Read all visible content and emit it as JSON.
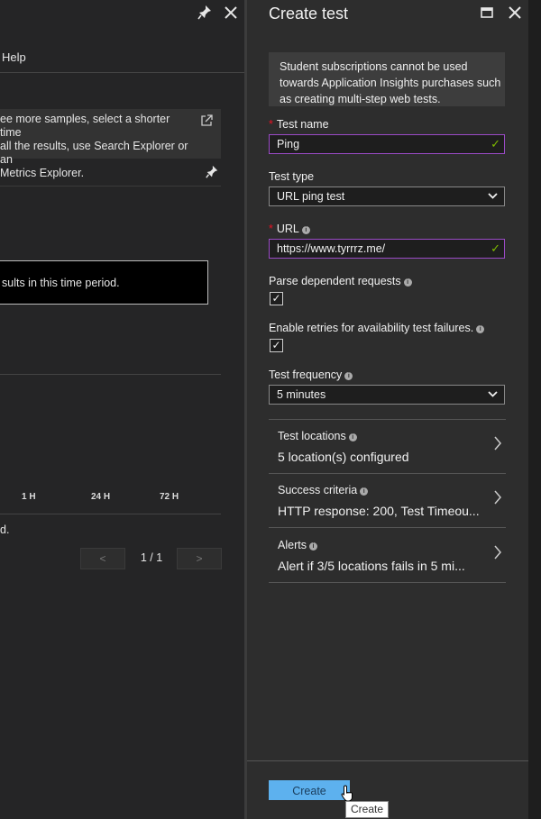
{
  "left_blade": {
    "pin_icon": "pin-icon",
    "close_icon": "close-icon",
    "menu_help": "Help",
    "info_text": "ee more samples, select a shorter time\nall the results, use Search Explorer or an\nMetrics Explorer.",
    "external_link_icon": "external-link-icon",
    "notice": "sults in this time period.",
    "time_ranges": [
      "1 H",
      "24 H",
      "72 H"
    ],
    "truncated_text": "d.",
    "pager": {
      "prev": "<",
      "label": "1 / 1",
      "next": ">"
    }
  },
  "create_test": {
    "title": "Create test",
    "maximize_icon": "maximize-icon",
    "close_icon": "close-icon",
    "notice": "Student subscriptions cannot be used towards Application Insights purchases such as creating multi-step web tests.",
    "test_name": {
      "label": "Test name",
      "required": "*",
      "value": "Ping"
    },
    "test_type": {
      "label": "Test type",
      "value": "URL ping test"
    },
    "url": {
      "label": "URL",
      "required": "*",
      "value": "https://www.tyrrrz.me/"
    },
    "parse_dependent": {
      "label": "Parse dependent requests",
      "checked": true
    },
    "enable_retries": {
      "label": "Enable retries for availability test failures.",
      "checked": true
    },
    "test_frequency": {
      "label": "Test frequency",
      "value": "5 minutes"
    },
    "rows": [
      {
        "label": "Test locations",
        "value": "5 location(s) configured"
      },
      {
        "label": "Success criteria",
        "value": "HTTP response: 200, Test Timeou..."
      },
      {
        "label": "Alerts",
        "value": "Alert if 3/5 locations fails in 5 mi..."
      }
    ],
    "create_button": "Create",
    "tooltip": "Create"
  },
  "colors": {
    "accent_button": "#5db1ee",
    "valid_check": "#7fba00",
    "required": "#e81123"
  }
}
